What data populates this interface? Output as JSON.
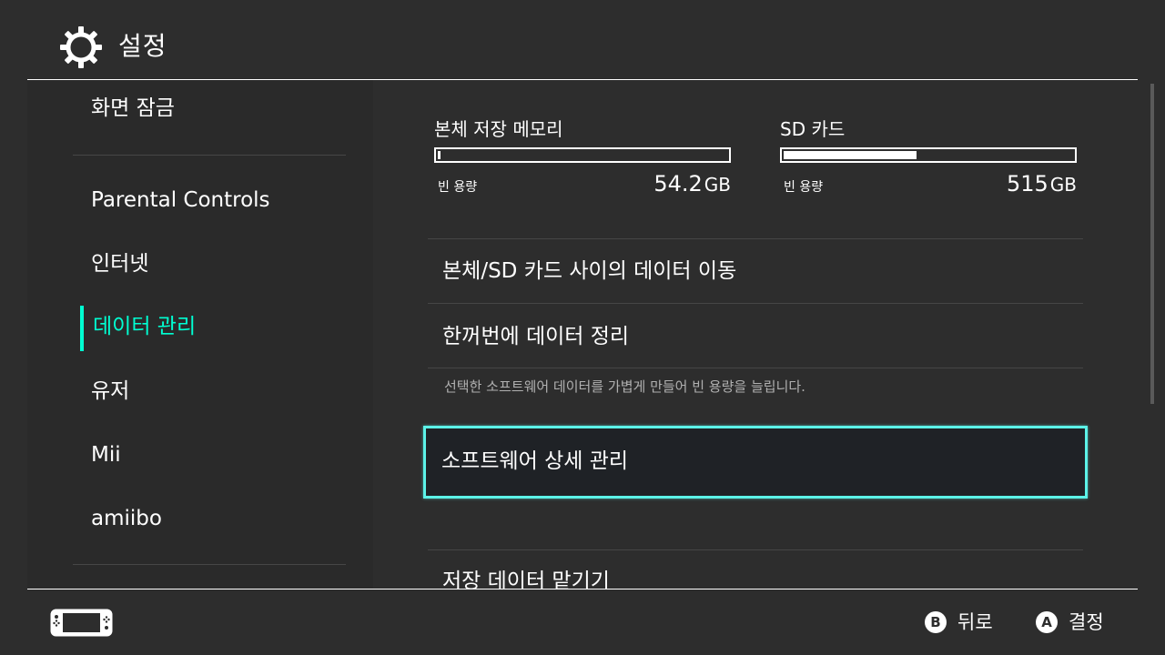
{
  "header": {
    "title": "설정",
    "icon": "gear-icon"
  },
  "sidebar": {
    "items": [
      {
        "label": "화면 잠금"
      },
      {
        "label": "Parental Controls"
      },
      {
        "label": "인터넷"
      },
      {
        "label": "데이터 관리",
        "active": true
      },
      {
        "label": "유저"
      },
      {
        "label": "Mii"
      },
      {
        "label": "amiibo"
      }
    ],
    "accent_color": "#00ffd2"
  },
  "storage": {
    "system": {
      "label": "본체 저장 메모리",
      "free_label": "빈 용량",
      "free_value": "54.2",
      "free_unit": "GB",
      "used_fraction": 0.01
    },
    "sd": {
      "label": "SD 카드",
      "free_label": "빈 용량",
      "free_value": "515",
      "free_unit": "GB",
      "used_fraction": 0.46
    }
  },
  "menu": {
    "move_data": "본체/SD 카드 사이의 데이터 이동",
    "quick_archive": "한꺼번에 데이터 정리",
    "quick_archive_desc": "선택한 소프트웨어 데이터를 가볍게 만들어 빈 용량을 늘립니다.",
    "manage_software": "소프트웨어 상세 관리",
    "manage_save_data": "저장 데이터 맡기기"
  },
  "footer": {
    "back": {
      "button": "B",
      "label": "뒤로"
    },
    "ok": {
      "button": "A",
      "label": "결정"
    }
  },
  "colors": {
    "selection_border": "#5cf2e8",
    "background": "#2d2d2d"
  }
}
